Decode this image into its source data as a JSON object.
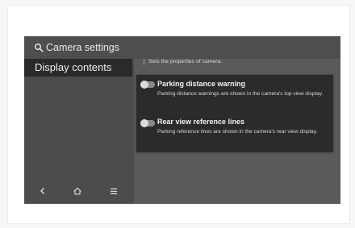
{
  "header": {
    "title": "Camera settings",
    "icon": "search-icon"
  },
  "sidebar": {
    "items": [
      {
        "label": "Display contents"
      }
    ],
    "nav": [
      {
        "icon": "back-icon",
        "glyph": "‹"
      },
      {
        "icon": "home-icon",
        "glyph": "⌂"
      },
      {
        "icon": "menu-icon",
        "glyph": "≡"
      }
    ]
  },
  "main": {
    "description": "Sets the properties of camera.",
    "options": [
      {
        "title": "Parking distance warning",
        "description": "Parking distance warnings are shown in the camera's top view display.",
        "enabled": false
      },
      {
        "title": "Rear view reference lines",
        "description": "Parking reference lines are shown in the camera's rear view display.",
        "enabled": false
      }
    ]
  },
  "colors": {
    "screen_bg": "#5a5a5a",
    "panel_bg": "#2b2b2b",
    "selected_item_bg": "#2a2a2a",
    "toggle_off": "#8a8a8a"
  }
}
